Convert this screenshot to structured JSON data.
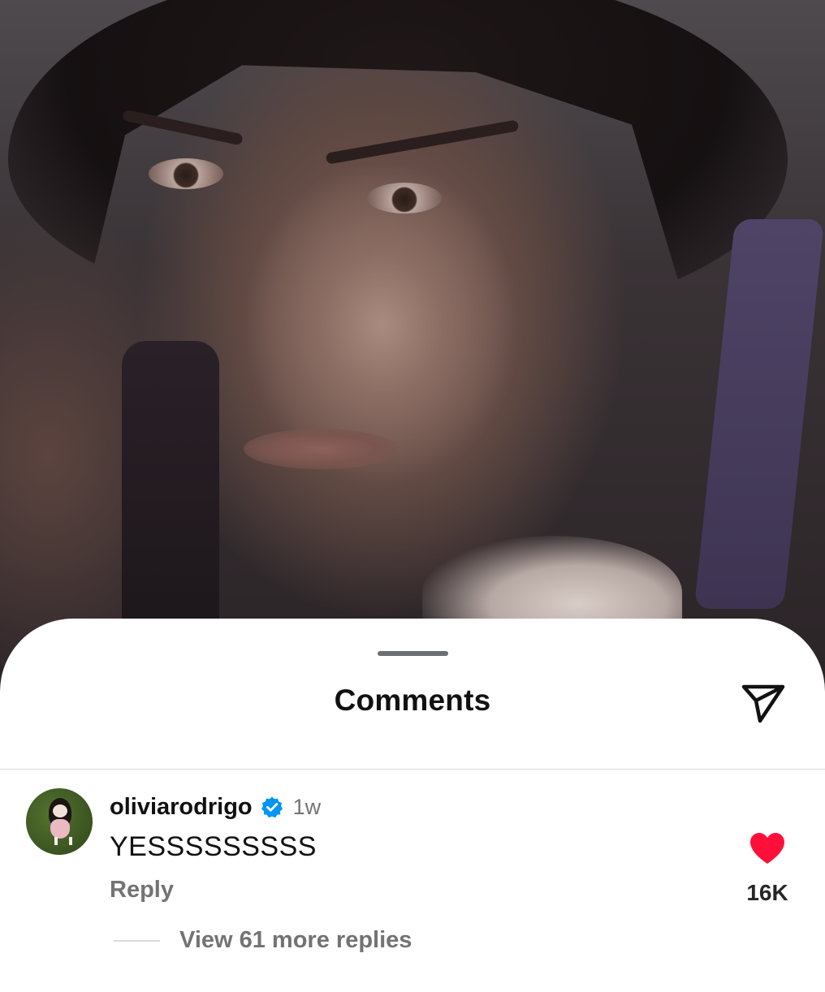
{
  "sheet": {
    "title": "Comments"
  },
  "comment": {
    "username": "oliviarodrigo",
    "verified": true,
    "time": "1w",
    "text": "YESSSSSSSSS",
    "reply_label": "Reply",
    "likes": "16K",
    "liked": true,
    "view_replies_label": "View 61 more replies"
  },
  "icons": {
    "share": "send-icon",
    "verified": "verified-badge-icon",
    "like": "heart-icon"
  },
  "colors": {
    "like": "#ff0f3a",
    "verified": "#0095f6",
    "secondary_text": "#737373"
  }
}
